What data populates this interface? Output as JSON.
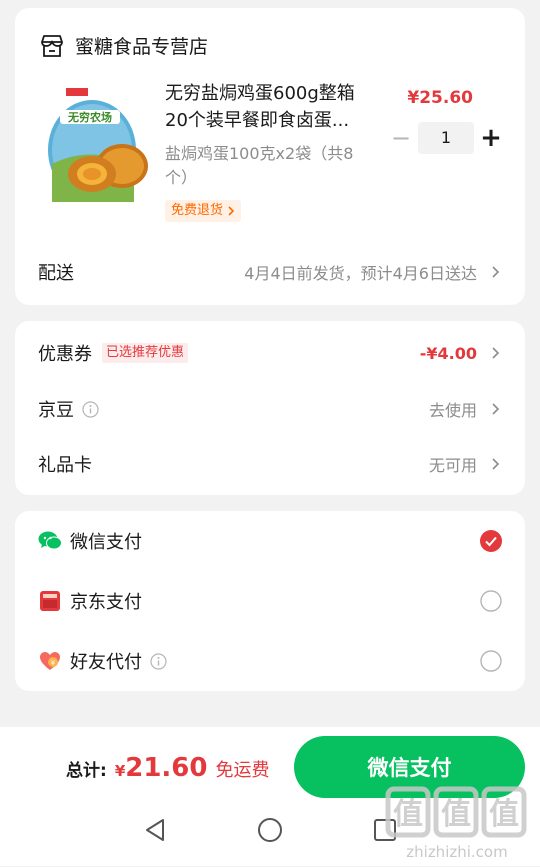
{
  "store": {
    "name": "蜜糖食品专营店",
    "icon": "store-icon"
  },
  "product": {
    "title": "无穷盐焗鸡蛋600g整箱20个装早餐即食卤蛋...",
    "price": "¥25.60",
    "spec": "盐焗鸡蛋100克x2袋（共8个）",
    "return_tag": "免费退货",
    "quantity": "1",
    "image_brand_text": "无穷农场"
  },
  "delivery": {
    "label": "配送",
    "value": "4月4日前发货，预计4月6日送达"
  },
  "discounts": {
    "coupon_label": "优惠券",
    "coupon_tag": "已选推荐优惠",
    "coupon_value": "-¥4.00",
    "jingdou_label": "京豆",
    "jingdou_value": "去使用",
    "giftcard_label": "礼品卡",
    "giftcard_value": "无可用"
  },
  "payment": {
    "options": [
      {
        "label": "微信支付",
        "icon": "wechat-pay-icon",
        "selected": true
      },
      {
        "label": "京东支付",
        "icon": "jd-pay-icon",
        "selected": false
      },
      {
        "label": "好友代付",
        "icon": "friend-pay-icon",
        "selected": false
      }
    ]
  },
  "footer": {
    "total_label": "总计:",
    "currency": "¥",
    "total_amount": "21.60",
    "free_shipping": "免运费",
    "pay_button": "微信支付"
  },
  "watermark": {
    "text": "值",
    "domain": "zhizhizhi.com"
  },
  "colors": {
    "accent_red": "#e4393c",
    "wechat_green": "#07c160",
    "return_tag_orange": "#ff6a00"
  }
}
